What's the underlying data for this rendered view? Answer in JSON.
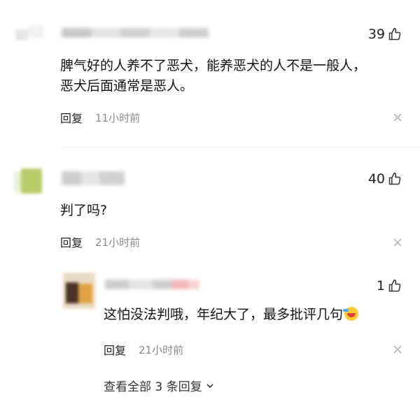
{
  "comments": [
    {
      "likes": "39",
      "text_lines": [
        "脾气好的人养不了恶犬，能养恶犬的人不是一般人，",
        "恶犬后面通常是恶人。"
      ],
      "reply_label": "回复",
      "time": "11小时前"
    },
    {
      "likes": "40",
      "text_lines": [
        "判了吗?"
      ],
      "reply_label": "回复",
      "time": "21小时前"
    }
  ],
  "reply": {
    "likes": "1",
    "text": "这怕没法判哦，年纪大了，最多批评几句",
    "reply_label": "回复",
    "time": "21小时前"
  },
  "expand_label": "查看全部 3 条回复",
  "icons": {
    "like": "thumbs-up-icon",
    "more": "more-options-icon",
    "expand": "chevron-down-icon",
    "emoji": "crying-laughing-emoji-icon"
  }
}
